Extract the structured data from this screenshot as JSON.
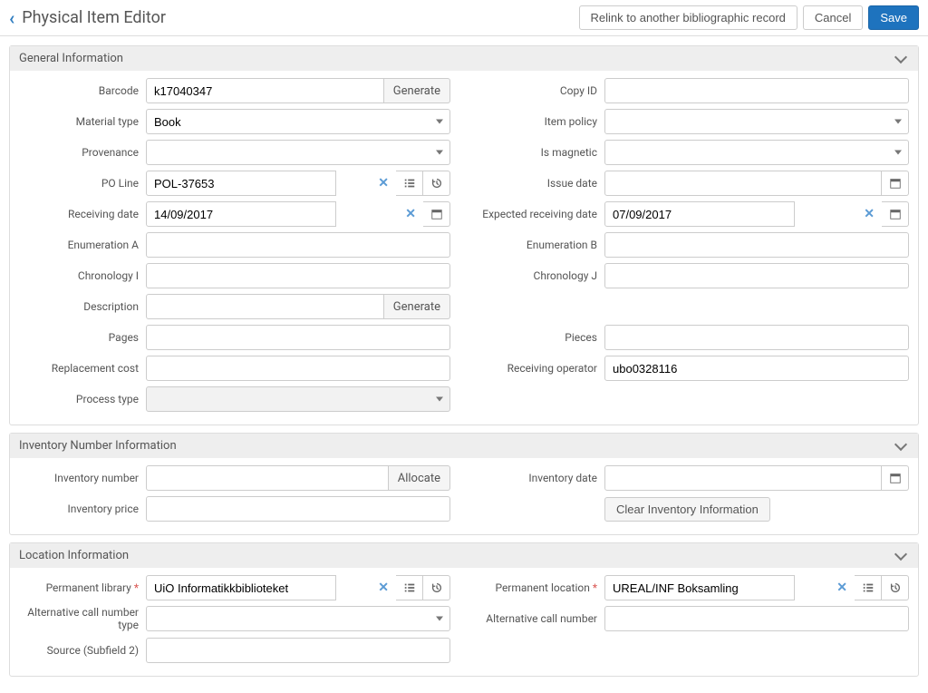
{
  "header": {
    "title": "Physical Item Editor",
    "relink": "Relink to another bibliographic record",
    "cancel": "Cancel",
    "save": "Save"
  },
  "sections": {
    "general": "General Information",
    "inventory": "Inventory Number Information",
    "location": "Location Information"
  },
  "labels": {
    "barcode": "Barcode",
    "copyid": "Copy ID",
    "material": "Material type",
    "policy": "Item policy",
    "provenance": "Provenance",
    "magnetic": "Is magnetic",
    "poline": "PO Line",
    "issuedate": "Issue date",
    "recvdate": "Receiving date",
    "exprecvdate": "Expected receiving date",
    "enumA": "Enumeration A",
    "enumB": "Enumeration B",
    "chronI": "Chronology I",
    "chronJ": "Chronology J",
    "desc": "Description",
    "pages": "Pages",
    "pieces": "Pieces",
    "replcost": "Replacement cost",
    "recvop": "Receiving operator",
    "proctype": "Process type",
    "invnum": "Inventory number",
    "invdate": "Inventory date",
    "invprice": "Inventory price",
    "permlib": "Permanent library",
    "permloc": "Permanent location",
    "altcalltype": "Alternative call number type",
    "altcall": "Alternative call number",
    "source": "Source (Subfield 2)"
  },
  "actions": {
    "generate": "Generate",
    "allocate": "Allocate",
    "clearinv": "Clear Inventory Information"
  },
  "values": {
    "barcode": "k17040347",
    "material": "Book",
    "poline": "POL-37653",
    "recvdate": "14/09/2017",
    "exprecvdate": "07/09/2017",
    "recvop": "ubo0328116",
    "permlib": "UiO Informatikkbiblioteket",
    "permloc": "UREAL/INF Boksamling"
  }
}
